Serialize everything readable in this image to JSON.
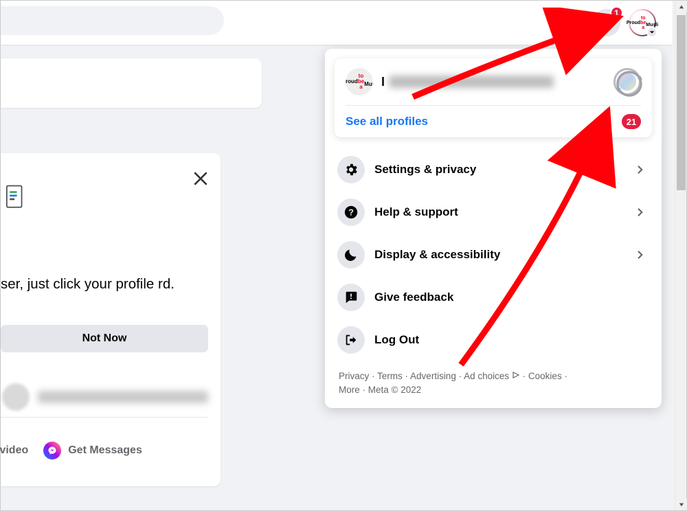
{
  "topbar": {
    "notification_count": "1"
  },
  "left": {
    "hint_text": "ser, just click your profile rd.",
    "not_now": "Not Now",
    "video_label": "/video",
    "get_messages": "Get Messages"
  },
  "panel": {
    "profile_prefix": "I",
    "see_all": "See all profiles",
    "profiles_count": "21",
    "menu": {
      "settings": "Settings & privacy",
      "help": "Help & support",
      "display": "Display & accessibility",
      "feedback": "Give feedback",
      "logout": "Log Out"
    },
    "footer": {
      "privacy": "Privacy",
      "terms": "Terms",
      "advertising": "Advertising",
      "adchoices": "Ad choices",
      "cookies": "Cookies",
      "more": "More",
      "meta": "Meta © 2022"
    }
  }
}
